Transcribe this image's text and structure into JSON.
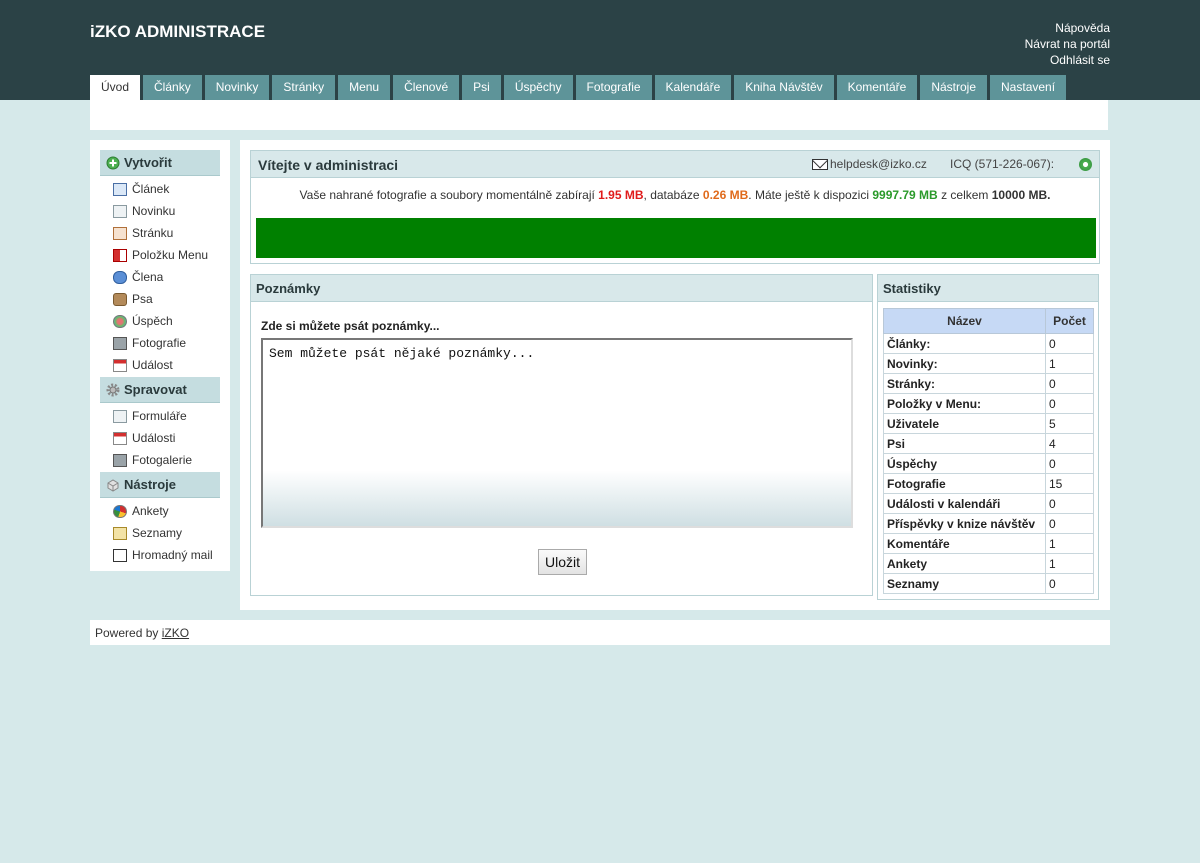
{
  "header": {
    "title": "iZKO ADMINISTRACE",
    "links": [
      "Nápověda",
      "Návrat na portál",
      "Odhlásit se"
    ]
  },
  "tabs": [
    {
      "label": "Úvod",
      "active": true
    },
    {
      "label": "Články"
    },
    {
      "label": "Novinky"
    },
    {
      "label": "Stránky"
    },
    {
      "label": "Menu"
    },
    {
      "label": "Členové"
    },
    {
      "label": "Psi"
    },
    {
      "label": "Úspěchy"
    },
    {
      "label": "Fotografie"
    },
    {
      "label": "Kalendáře"
    },
    {
      "label": "Kniha Návštěv"
    },
    {
      "label": "Komentáře"
    },
    {
      "label": "Nástroje"
    },
    {
      "label": "Nastavení"
    }
  ],
  "sidebar": {
    "create": {
      "title": "Vytvořit",
      "items": [
        "Článek",
        "Novinku",
        "Stránku",
        "Položku Menu",
        "Člena",
        "Psa",
        "Úspěch",
        "Fotografie",
        "Událost"
      ]
    },
    "manage": {
      "title": "Spravovat",
      "items": [
        "Formuláře",
        "Události",
        "Fotogalerie"
      ]
    },
    "tools": {
      "title": "Nástroje",
      "items": [
        "Ankety",
        "Seznamy",
        "Hromadný mail"
      ]
    }
  },
  "welcome": {
    "title": "Vítejte v administraci",
    "helpdesk": "helpdesk@izko.cz",
    "icq": "ICQ (571-226-067):",
    "usage_text_1": "Vaše nahrané fotografie a soubory momentálně zabírají",
    "photos_size": "1.95 MB",
    "usage_text_2": ", databáze",
    "db_size": "0.26 MB",
    "usage_text_3": ". Máte ještě k dispozici",
    "free_size": "9997.79 MB",
    "usage_text_4": "z celkem",
    "total_size": "10000 MB.",
    "bar_fill_percent": 100
  },
  "notes": {
    "title": "Poznámky",
    "label": "Zde si můžete psát poznámky...",
    "content": "Sem můžete psát nějaké poznámky...",
    "save_label": "Uložit"
  },
  "stats": {
    "title": "Statistiky",
    "columns": [
      "Název",
      "Počet"
    ],
    "rows": [
      {
        "name": "Články:",
        "count": "0"
      },
      {
        "name": "Novinky:",
        "count": "1"
      },
      {
        "name": "Stránky:",
        "count": "0"
      },
      {
        "name": "Položky v Menu:",
        "count": "0"
      },
      {
        "name": "Uživatele",
        "count": "5"
      },
      {
        "name": "Psi",
        "count": "4"
      },
      {
        "name": "Úspěchy",
        "count": "0"
      },
      {
        "name": "Fotografie",
        "count": "15"
      },
      {
        "name": "Události v kalendáři",
        "count": "0"
      },
      {
        "name": "Příspěvky v knize návštěv",
        "count": "0"
      },
      {
        "name": "Komentáře",
        "count": "1"
      },
      {
        "name": "Ankety",
        "count": "1"
      },
      {
        "name": "Seznamy",
        "count": "0"
      }
    ]
  },
  "footer": {
    "text": "Powered by",
    "link": "iZKO"
  },
  "colors": {
    "header_bg": "#2b4246",
    "tab_bg": "#5e9499",
    "page_bg": "#d6e9ea",
    "usage_bar": "#008000"
  }
}
